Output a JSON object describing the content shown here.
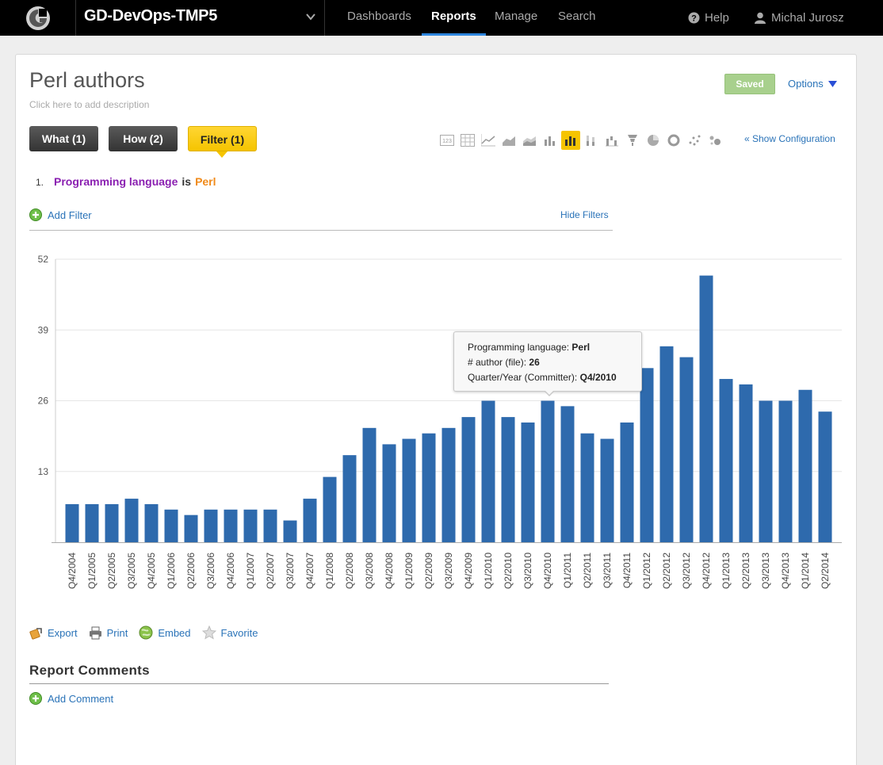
{
  "topbar": {
    "project_name": "GD-DevOps-TMP5",
    "nav": [
      "Dashboards",
      "Reports",
      "Manage",
      "Search"
    ],
    "active_nav": "Reports",
    "help_label": "Help",
    "user_name": "Michal Jurosz"
  },
  "report": {
    "title": "Perl authors",
    "description_placeholder": "Click here to add description",
    "saved_label": "Saved",
    "options_label": "Options",
    "tabs": {
      "what": "What (1)",
      "how": "How (2)",
      "filter": "Filter (1)"
    },
    "active_tab": "filter",
    "chart_types": [
      "table-number-icon",
      "table-icon",
      "line-chart-icon",
      "area-chart-icon",
      "stacked-area-icon",
      "bar-chart-icon",
      "column-chart-icon",
      "stacked-column-icon",
      "waterfall-icon",
      "funnel-icon",
      "pie-chart-icon",
      "donut-chart-icon",
      "scatter-icon",
      "bubble-icon"
    ],
    "active_chart_type": "column-chart-icon",
    "show_config_label": "« Show Configuration"
  },
  "filters": {
    "items": [
      {
        "number": "1.",
        "attribute": "Programming language",
        "operator": "is",
        "value": "Perl"
      }
    ],
    "add_filter_label": "Add Filter",
    "hide_filters_label": "Hide Filters"
  },
  "actions": {
    "export": "Export",
    "print": "Print",
    "embed": "Embed",
    "favorite": "Favorite"
  },
  "comments": {
    "title": "Report Comments",
    "add_comment_label": "Add Comment"
  },
  "tooltip": {
    "line1_label": "Programming language:",
    "line1_value": "Perl",
    "line2_label": "# author (file):",
    "line2_value": "26",
    "line3_label": "Quarter/Year (Committer):",
    "line3_value": "Q4/2010"
  },
  "colors": {
    "bar": "#2e6aad",
    "link": "#2a73b8",
    "active_tab": "#f5c400",
    "saved": "#a8d08d",
    "filter_attribute": "#8a1fb1",
    "filter_value": "#f08a1a"
  },
  "chart_data": {
    "type": "bar",
    "categories": [
      "Q4/2004",
      "Q1/2005",
      "Q2/2005",
      "Q3/2005",
      "Q4/2005",
      "Q1/2006",
      "Q2/2006",
      "Q3/2006",
      "Q4/2006",
      "Q1/2007",
      "Q2/2007",
      "Q3/2007",
      "Q4/2007",
      "Q1/2008",
      "Q2/2008",
      "Q3/2008",
      "Q4/2008",
      "Q1/2009",
      "Q2/2009",
      "Q3/2009",
      "Q4/2009",
      "Q1/2010",
      "Q2/2010",
      "Q3/2010",
      "Q4/2010",
      "Q1/2011",
      "Q2/2011",
      "Q3/2011",
      "Q4/2011",
      "Q1/2012",
      "Q2/2012",
      "Q3/2012",
      "Q4/2012",
      "Q1/2013",
      "Q2/2013",
      "Q3/2013",
      "Q4/2013",
      "Q1/2014",
      "Q2/2014"
    ],
    "values": [
      7,
      7,
      7,
      8,
      7,
      6,
      5,
      6,
      6,
      6,
      6,
      4,
      8,
      12,
      16,
      21,
      18,
      19,
      20,
      21,
      23,
      26,
      23,
      22,
      26,
      25,
      20,
      19,
      22,
      32,
      36,
      34,
      49,
      30,
      29,
      26,
      26,
      28,
      24
    ],
    "title": "",
    "xlabel": "",
    "ylabel": "",
    "yticks": [
      13,
      26,
      39,
      52
    ],
    "ylim": [
      0,
      52
    ],
    "grid": true,
    "legend": "none"
  }
}
